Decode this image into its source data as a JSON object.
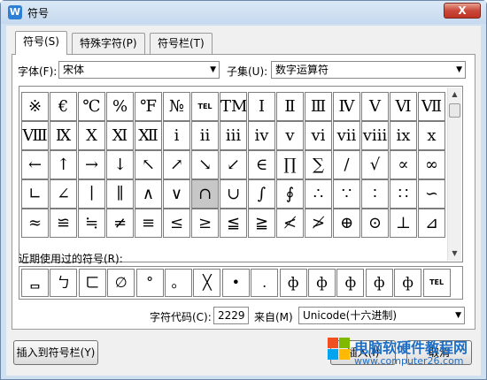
{
  "window": {
    "title": "符号",
    "close_label": "X"
  },
  "tabs": [
    {
      "label": "符号(S)",
      "active": true
    },
    {
      "label": "特殊字符(P)",
      "active": false
    },
    {
      "label": "符号栏(T)",
      "active": false
    }
  ],
  "font": {
    "label": "字体(F):",
    "value": "宋体"
  },
  "subset": {
    "label": "子集(U):",
    "value": "数字运算符"
  },
  "symbols": [
    [
      "※",
      "€",
      "℃",
      "%",
      "℉",
      "№",
      "TEL",
      "TM",
      "Ⅰ",
      "Ⅱ",
      "Ⅲ",
      "Ⅳ",
      "Ⅴ",
      "Ⅵ",
      "Ⅶ"
    ],
    [
      "Ⅷ",
      "Ⅸ",
      "Ⅹ",
      "Ⅺ",
      "Ⅻ",
      "ⅰ",
      "ⅱ",
      "ⅲ",
      "ⅳ",
      "ⅴ",
      "ⅵ",
      "ⅶ",
      "ⅷ",
      "ⅸ",
      "ⅹ"
    ],
    [
      "←",
      "↑",
      "→",
      "↓",
      "↖",
      "↗",
      "↘",
      "↙",
      "∈",
      "∏",
      "∑",
      "∕",
      "√",
      "∝",
      "∞"
    ],
    [
      "∟",
      "∠",
      "∣",
      "∥",
      "∧",
      "∨",
      "∩",
      "∪",
      "∫",
      "∮",
      "∴",
      "∵",
      "∶",
      "∷",
      "∽"
    ],
    [
      "≈",
      "≌",
      "≒",
      "≠",
      "≡",
      "≤",
      "≥",
      "≦",
      "≧",
      "≮",
      "≯",
      "⊕",
      "⊙",
      "⊥",
      "⊿"
    ]
  ],
  "selected_symbol": "∩",
  "recent": {
    "label": "近期使用过的符号(R):",
    "items": [
      "ᆷ",
      "ㄅ",
      "ㄈ",
      "∅",
      "°",
      "。",
      "╳",
      "•",
      ".",
      "ф",
      "ф",
      "ф",
      "ф",
      "ф",
      "TEL"
    ]
  },
  "char_code": {
    "label": "字符代码(C):",
    "value": "2229"
  },
  "from": {
    "label": "来自(M)",
    "value": "Unicode(十六进制)"
  },
  "buttons": {
    "insert_to_bar": "插入到符号栏(Y)",
    "insert": "插入(I)",
    "cancel": "取消"
  },
  "watermark": {
    "title": "电脑软硬件教程网",
    "url": "www.computer26.com"
  }
}
